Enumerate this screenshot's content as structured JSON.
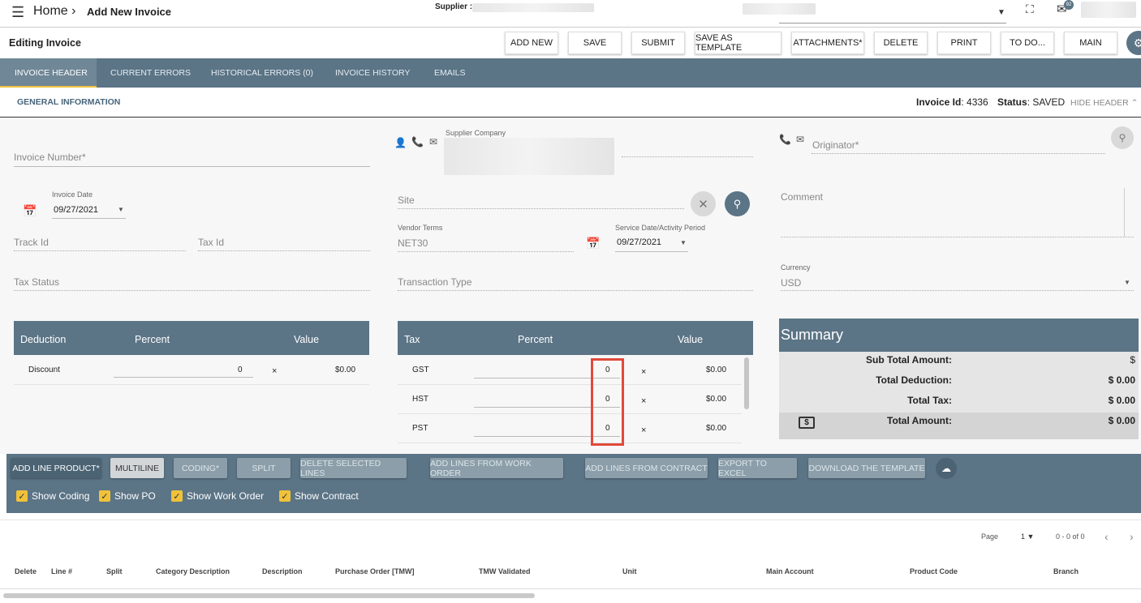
{
  "topbar": {
    "home": "Home",
    "title": "Add New Invoice",
    "supplier_label": "Supplier :",
    "notification_count": "92"
  },
  "toolbar": {
    "editing": "Editing Invoice",
    "buttons": [
      "ADD NEW",
      "SAVE",
      "SUBMIT",
      "SAVE AS TEMPLATE",
      "ATTACHMENTS*",
      "DELETE",
      "PRINT",
      "TO DO...",
      "MAIN"
    ]
  },
  "tabs": [
    "INVOICE HEADER",
    "CURRENT ERRORS",
    "HISTORICAL ERRORS (0)",
    "INVOICE HISTORY",
    "EMAILS"
  ],
  "header": {
    "section": "GENERAL INFORMATION",
    "invoice_id_label": "Invoice Id",
    "invoice_id": ": 4336",
    "status_label": "Status",
    "status": ": SAVED",
    "hide_header": "HIDE HEADER"
  },
  "form": {
    "invoice_number": "Invoice Number*",
    "invoice_date_label": "Invoice Date",
    "invoice_date": "09/27/2021",
    "track_id": "Track Id",
    "tax_id": "Tax Id",
    "tax_status": "Tax Status",
    "supplier_company": "Supplier Company",
    "site": "Site",
    "vendor_terms_label": "Vendor Terms",
    "vendor_terms": "NET30",
    "service_date_label": "Service Date/Activity Period",
    "service_date": "09/27/2021",
    "transaction_type": "Transaction Type",
    "originator": "Originator*",
    "comment": "Comment",
    "currency_label": "Currency",
    "currency": "USD"
  },
  "deduction_table": {
    "headers": [
      "Deduction",
      "Percent",
      "Value"
    ],
    "rows": [
      {
        "name": "Discount",
        "percent": "0",
        "value": "$0.00"
      }
    ]
  },
  "tax_table": {
    "headers": [
      "Tax",
      "Percent",
      "Value"
    ],
    "rows": [
      {
        "name": "GST",
        "percent": "0",
        "value": "$0.00"
      },
      {
        "name": "HST",
        "percent": "0",
        "value": "$0.00"
      },
      {
        "name": "PST",
        "percent": "0",
        "value": "$0.00"
      }
    ]
  },
  "summary": {
    "title": "Summary",
    "sub_total_label": "Sub Total Amount:",
    "sub_total": "$",
    "deduction_label": "Total Deduction:",
    "deduction": "$ 0.00",
    "tax_label": "Total Tax:",
    "tax": "$ 0.00",
    "amount_label": "Total Amount:",
    "amount": "$ 0.00"
  },
  "line_actions": [
    "ADD LINE PRODUCT*",
    "MULTILINE",
    "CODING*",
    "SPLIT",
    "DELETE SELECTED LINES",
    "ADD LINES FROM WORK ORDER",
    "ADD LINES FROM CONTRACT",
    "EXPORT TO EXCEL",
    "DOWNLOAD THE TEMPLATE"
  ],
  "checkboxes": [
    "Show Coding",
    "Show PO",
    "Show Work Order",
    "Show Contract"
  ],
  "pager": {
    "page_label": "Page",
    "page": "1",
    "range": "0 - 0 of 0"
  },
  "grid_headers": [
    "Delete",
    "Line #",
    "Split",
    "Category Description",
    "Description",
    "Purchase Order [TMW]",
    "TMW Validated",
    "Unit",
    "Main Account",
    "Product Code",
    "Branch"
  ],
  "colors": {
    "header_bg": "#5b7486",
    "accent": "#f0c23a",
    "highlight": "#e2493b"
  }
}
